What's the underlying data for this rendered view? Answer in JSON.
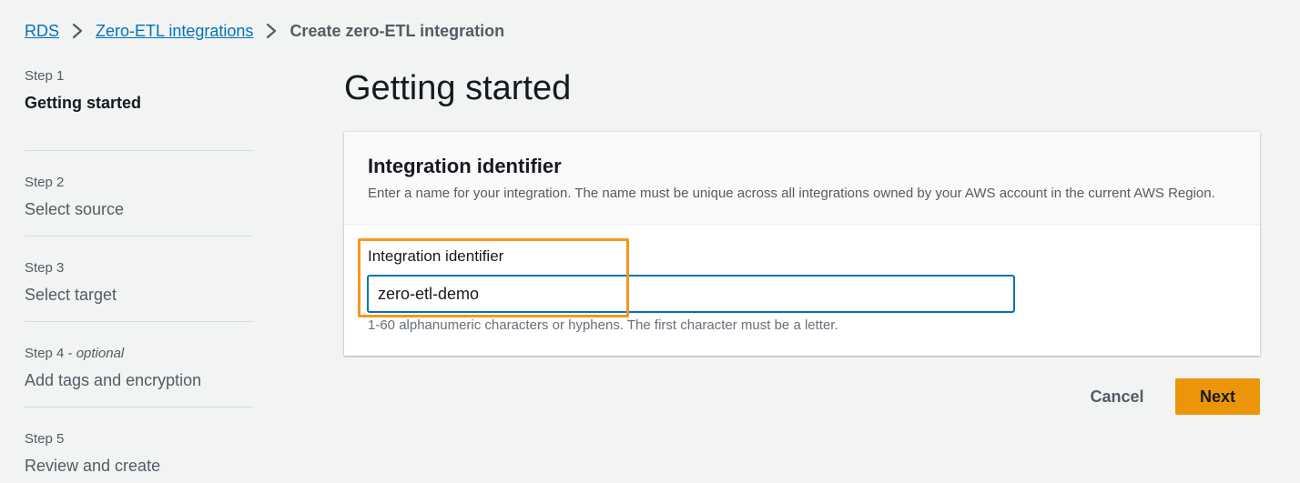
{
  "breadcrumb": {
    "items": [
      {
        "label": "RDS"
      },
      {
        "label": "Zero-ETL integrations"
      }
    ],
    "current": "Create zero-ETL integration"
  },
  "steps": [
    {
      "number": "Step 1",
      "optional": "",
      "title": "Getting started",
      "active": true
    },
    {
      "number": "Step 2",
      "optional": "",
      "title": "Select source",
      "active": false
    },
    {
      "number": "Step 3",
      "optional": "",
      "title": "Select target",
      "active": false
    },
    {
      "number": "Step 4 - ",
      "optional": "optional",
      "title": "Add tags and encryption",
      "active": false
    },
    {
      "number": "Step 5",
      "optional": "",
      "title": "Review and create",
      "active": false
    }
  ],
  "main": {
    "title": "Getting started",
    "card": {
      "title": "Integration identifier",
      "description": "Enter a name for your integration. The name must be unique across all integrations owned by your AWS account in the current AWS Region.",
      "field_label": "Integration identifier",
      "field_value": "zero-etl-demo",
      "field_hint": "1-60 alphanumeric characters or hyphens. The first character must be a letter."
    }
  },
  "actions": {
    "cancel": "Cancel",
    "next": "Next"
  },
  "colors": {
    "link": "#0073bb",
    "primary_button": "#ec9508",
    "highlight": "#f7951d",
    "input_border": "#0073bb"
  }
}
